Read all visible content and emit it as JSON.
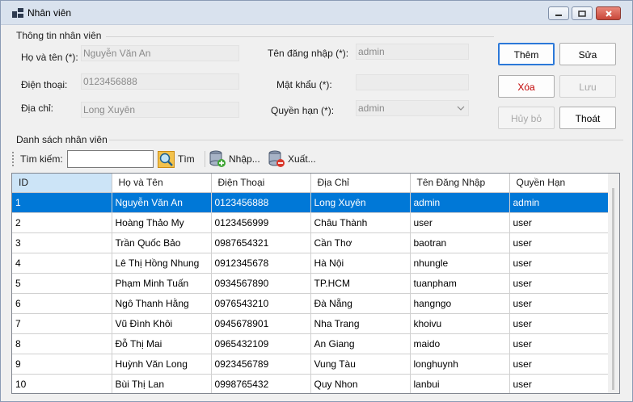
{
  "window": {
    "title": "Nhân  viên"
  },
  "info_group": {
    "title": "Thông tin nhân viên",
    "fullname_label": "Họ và tên (*):",
    "fullname_value": "Nguyễn Văn An",
    "phone_label": "Điện thoại:",
    "phone_value": "0123456888",
    "address_label": "Địa chỉ:",
    "address_value": "Long Xuyên",
    "username_label": "Tên đăng nhập (*):",
    "username_value": "admin",
    "password_label": "Mật khẩu (*):",
    "password_value": "",
    "role_label": "Quyền hạn (*):",
    "role_value": "admin"
  },
  "buttons": {
    "add": "Thêm",
    "edit": "Sửa",
    "delete": "Xóa",
    "save": "Lưu",
    "cancel": "Hủy bỏ",
    "exit": "Thoát"
  },
  "list_group": {
    "title": "Danh sách nhân viên"
  },
  "toolbar": {
    "search_label": "Tìm kiếm:",
    "search_value": "",
    "find_label": "Tìm",
    "import_label": "Nhập...",
    "export_label": "Xuất..."
  },
  "grid": {
    "columns": [
      "ID",
      "Họ và Tên",
      "Điện Thoại",
      "Địa Chỉ",
      "Tên Đăng Nhập",
      "Quyền Hạn"
    ],
    "rows": [
      [
        "1",
        "Nguyễn Văn An",
        "0123456888",
        "Long Xuyên",
        "admin",
        "admin"
      ],
      [
        "2",
        "Hoàng Thảo My",
        "0123456999",
        "Châu Thành",
        "user",
        "user"
      ],
      [
        "3",
        "Trần Quốc Bảo",
        "0987654321",
        "Cần Thơ",
        "baotran",
        "user"
      ],
      [
        "4",
        "Lê Thị Hồng Nhung",
        "0912345678",
        "Hà Nội",
        "nhungle",
        "user"
      ],
      [
        "5",
        "Phạm Minh Tuấn",
        "0934567890",
        "TP.HCM",
        "tuanpham",
        "user"
      ],
      [
        "6",
        "Ngô Thanh Hằng",
        "0976543210",
        "Đà Nẵng",
        "hangngo",
        "user"
      ],
      [
        "7",
        "Vũ Đình Khôi",
        "0945678901",
        "Nha Trang",
        "khoivu",
        "user"
      ],
      [
        "8",
        "Đỗ Thị Mai",
        "0965432109",
        "An Giang",
        "maido",
        "user"
      ],
      [
        "9",
        "Huỳnh Văn Long",
        "0923456789",
        "Vung Tàu",
        "longhuynh",
        "user"
      ],
      [
        "10",
        "Bùi Thị Lan",
        "0998765432",
        "Quy Nhon",
        "lanbui",
        "user"
      ]
    ]
  },
  "colors": {
    "selection": "#0078d7",
    "accent_border": "#2b78d8",
    "delete_text": "#c00000"
  }
}
